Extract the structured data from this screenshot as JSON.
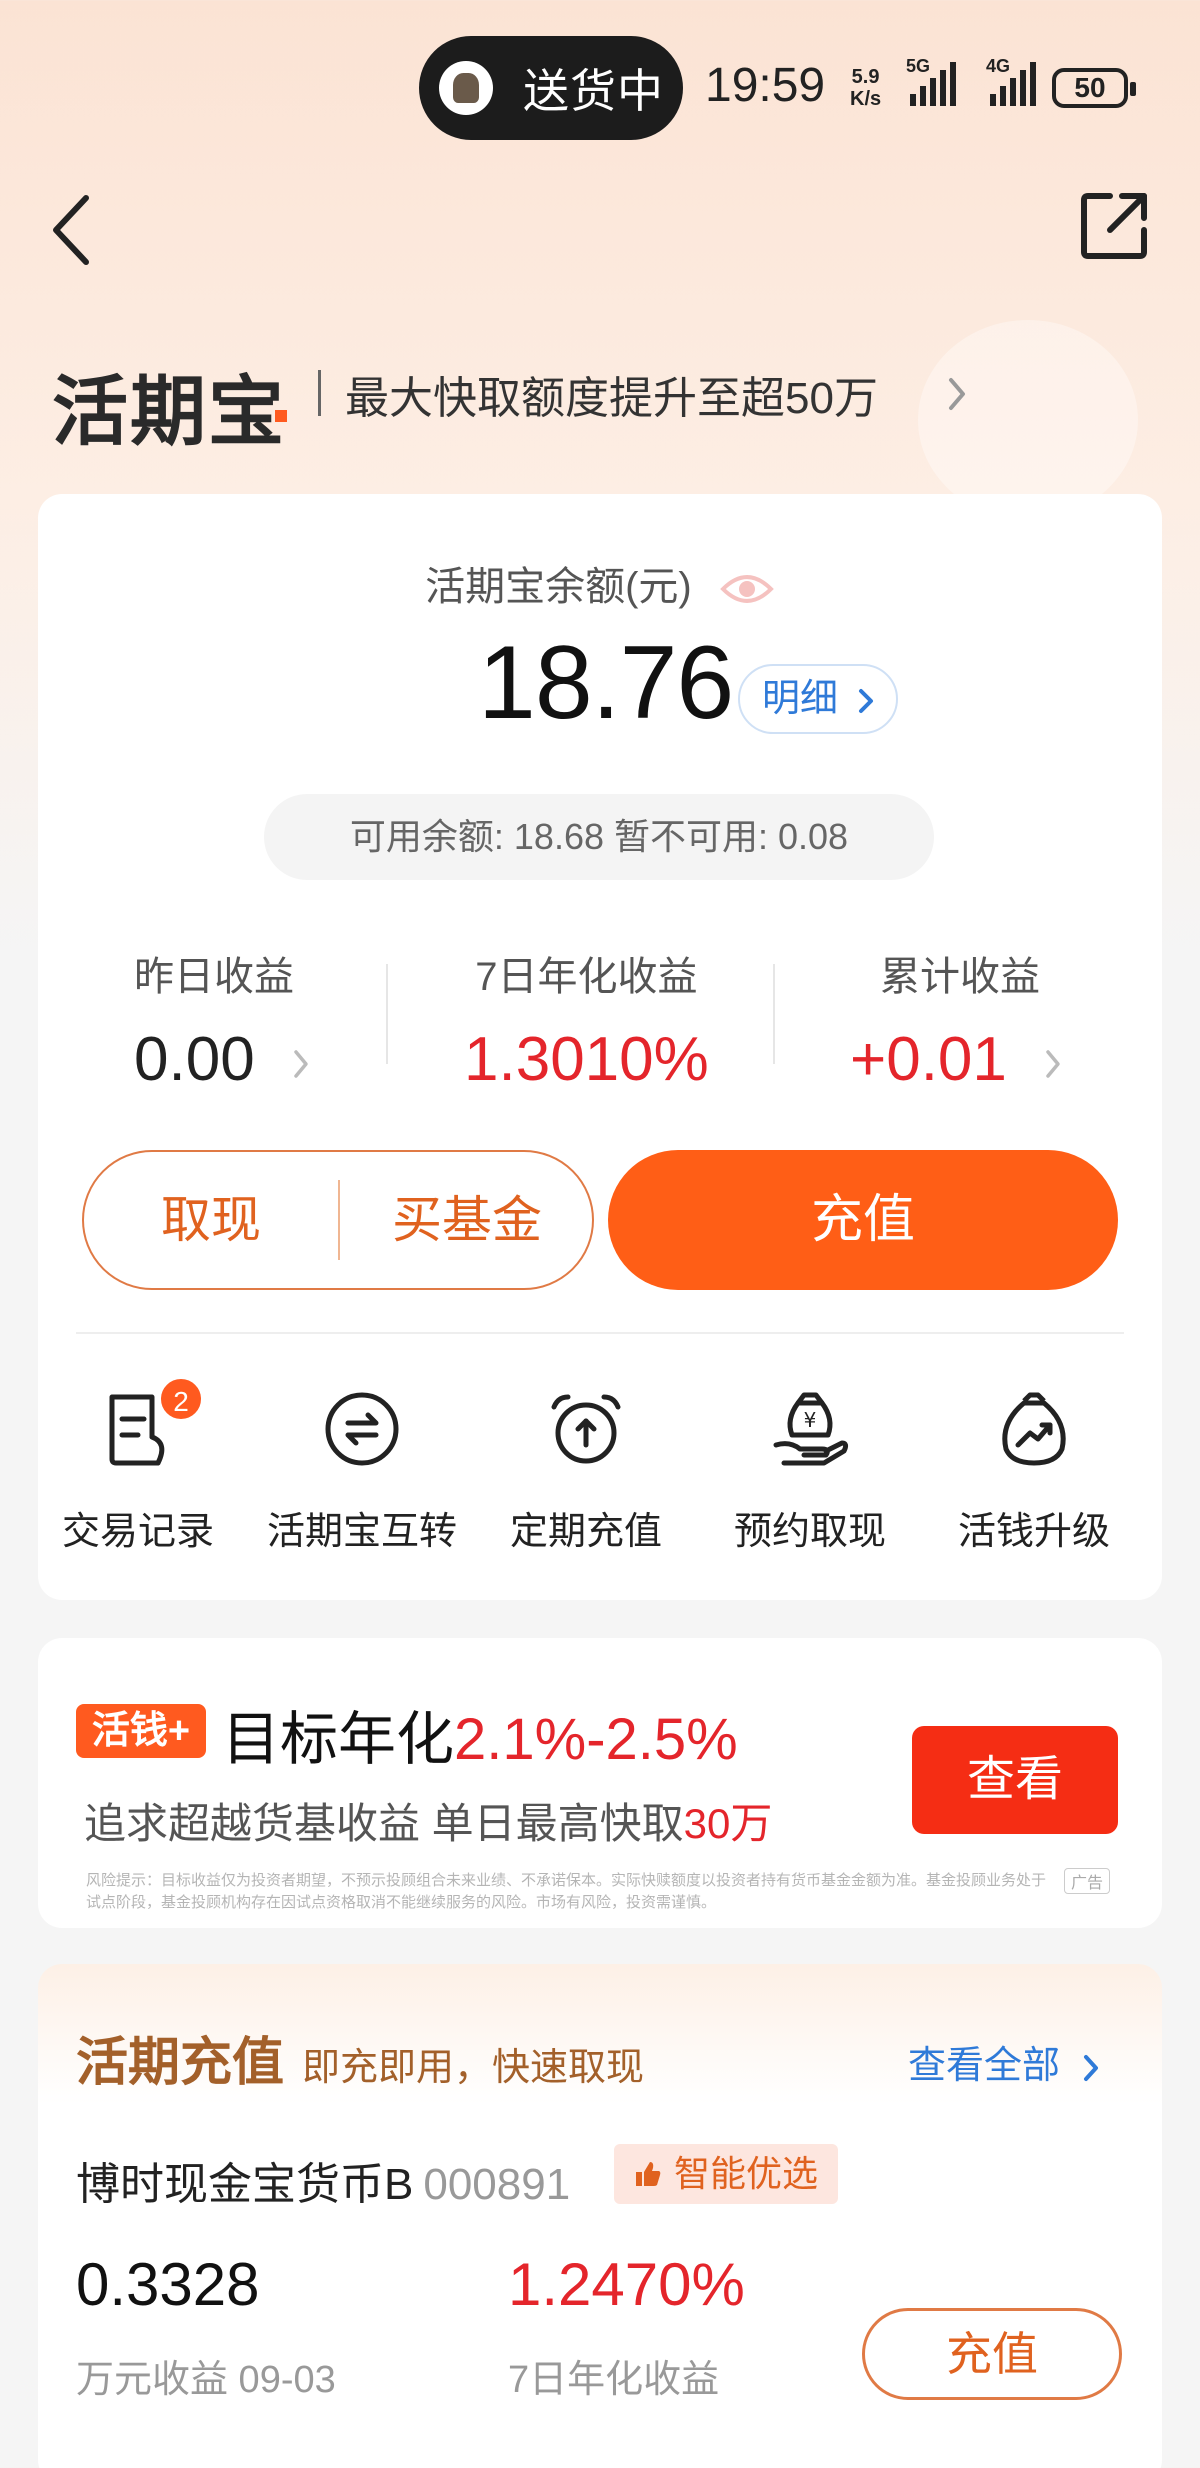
{
  "status_bar": {
    "delivery_text": "送货中",
    "time": "19:59",
    "net_speed_value": "5.9",
    "net_speed_unit": "K/s",
    "sig1_label": "5G",
    "sig2_label": "4G",
    "battery": "50"
  },
  "header": {
    "brand": "活期宝",
    "slogan": "最大快取额度提升至超50万"
  },
  "balance": {
    "label": "活期宝余额(元)",
    "value": "18.76",
    "detail_label": "明细",
    "available_text": "可用余额: 18.68  暂不可用: 0.08"
  },
  "stats": [
    {
      "label": "昨日收益",
      "value": "0.00"
    },
    {
      "label": "7日年化收益",
      "value": "1.3010%"
    },
    {
      "label": "累计收益",
      "value": "+0.01"
    }
  ],
  "actions": {
    "withdraw": "取现",
    "buy_fund": "买基金",
    "recharge": "充值"
  },
  "quick_entries": [
    {
      "label": "交易记录",
      "icon": "transaction-record-icon",
      "badge": "2"
    },
    {
      "label": "活期宝互转",
      "icon": "transfer-icon"
    },
    {
      "label": "定期充值",
      "icon": "alarm-clock-icon"
    },
    {
      "label": "预约取现",
      "icon": "money-bag-hand-icon"
    },
    {
      "label": "活钱升级",
      "icon": "growth-bag-icon"
    }
  ],
  "promo": {
    "tag": "活钱+",
    "title_prefix": "目标年化",
    "title_rate": "2.1%-2.5%",
    "sub_prefix": "追求超越货基收益  单日最高快取",
    "sub_amount": "30万",
    "button": "查看",
    "risk_text": "风险提示：目标收益仅为投资者期望，不预示投顾组合未来业绩、不承诺保本。实际快赎额度以投资者持有货币基金金额为准。基金投顾业务处于试点阶段，基金投顾机构存在因试点资格取消不能继续服务的风险。市场有风险，投资需谨慎。",
    "ad_label": "广告"
  },
  "fund_section": {
    "title": "活期充值",
    "subtitle": "即充即用，快速取现",
    "view_all": "查看全部",
    "fund_name": "博时现金宝货币B",
    "fund_code": "000891",
    "smart_tag": "智能优选",
    "per_10k_value": "0.3328",
    "per_10k_label": "万元收益 09-03",
    "annual_value": "1.2470%",
    "annual_label": "7日年化收益",
    "button": "充值"
  }
}
